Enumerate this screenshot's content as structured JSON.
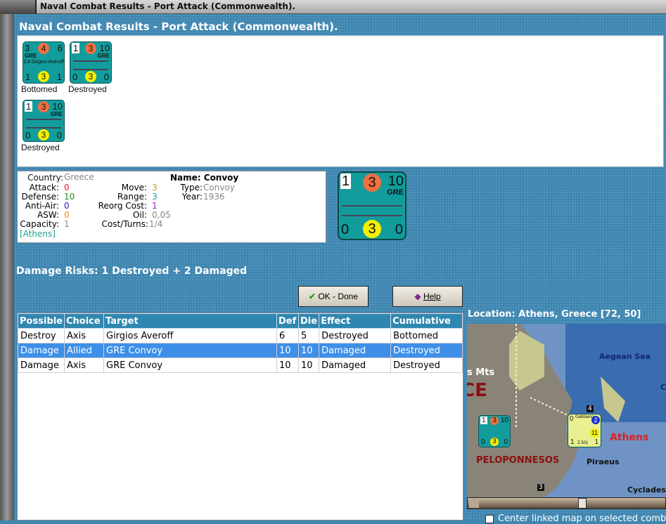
{
  "window_title": "Naval Combat Results - Port Attack (Commonwealth).",
  "dialog_title": "Naval Combat Results - Port Attack (Commonwealth).",
  "results": [
    {
      "attack": "3",
      "circle_top": "4",
      "defense": "6",
      "nation": "GRE",
      "name": "CA Girgios Averoff",
      "bl": "1",
      "circle_bottom": "3",
      "br": "1",
      "label": "Bottomed"
    },
    {
      "attack": "1",
      "circle_top": "3",
      "defense": "10",
      "nation": "GRE",
      "bl": "0",
      "circle_bottom": "3",
      "br": "0",
      "label": "Destroyed"
    },
    {
      "attack": "1",
      "circle_top": "3",
      "defense": "10",
      "nation": "GRE",
      "bl": "0",
      "circle_bottom": "3",
      "br": "0",
      "label": "Destroyed"
    }
  ],
  "info": {
    "country_label": "Country:",
    "country": "Greece",
    "attack_label": "Attack:",
    "attack": "0",
    "defense_label": "Defense:",
    "defense": "10",
    "antiair_label": "Anti-Air:",
    "antiair": "0",
    "asw_label": "ASW:",
    "asw": "0",
    "capacity_label": "Capacity:",
    "capacity": "1",
    "location": "[Athens]",
    "move_label": "Move:",
    "move": "3",
    "range_label": "Range:",
    "range": "3",
    "reorg_label": "Reorg Cost:",
    "reorg": "1",
    "oil_label": "Oil:",
    "oil": "0,05",
    "cost_label": "Cost/Turns:",
    "cost": "1/4",
    "name": "Name: Convoy",
    "type_label": "Type:",
    "type": "Convoy",
    "year_label": "Year:",
    "year": "1936",
    "colors": {
      "attack": "#e02020",
      "defense": "#209020",
      "antiair": "#2020c0",
      "asw": "#f09030",
      "move": "#c0a020",
      "range": "#20a0a0",
      "reorg": "#a020c0"
    }
  },
  "big_counter": {
    "attack": "1",
    "circle_top": "3",
    "defense": "10",
    "nation": "GRE",
    "bl": "0",
    "circle_bottom": "3",
    "br": "0"
  },
  "damage_risks": "Damage Risks:  1 Destroyed + 2 Damaged",
  "buttons": {
    "ok": "OK - Done",
    "help": "Help"
  },
  "table": {
    "headers": [
      "Possible",
      "Choice",
      "Target",
      "Def",
      "Die",
      "Effect",
      "Cumulative"
    ],
    "rows": [
      [
        "Destroy",
        "Axis",
        "Girgios Averoff",
        "6",
        "5",
        "Destroyed",
        "Bottomed"
      ],
      [
        "Damage",
        "Allied",
        "GRE Convoy",
        "10",
        "10",
        "Damaged",
        "Destroyed"
      ],
      [
        "Damage",
        "Axis",
        "GRE Convoy",
        "10",
        "10",
        "Damaged",
        "Destroyed"
      ]
    ]
  },
  "location": "Location:  Athens, Greece [72, 50]",
  "map": {
    "labels": {
      "mts": "s Mts",
      "sea": "Aegean Sea",
      "ce": "CE",
      "pelo": "PELOPONNESOS",
      "athens": "Athens",
      "piraeus": "Piraeus",
      "cyclades": "Cyclades",
      "c": "C"
    },
    "stack4": "4",
    "stack3": "3",
    "unit": {
      "name": "Gabbiano",
      "top_right": "2",
      "mid": "11",
      "bl": "1",
      "code": "Z.501",
      "br": "1",
      "tl": "0"
    },
    "convoy": {
      "attack": "1",
      "circle_top": "3",
      "defense": "10",
      "bl": "0",
      "circle_bottom": "3",
      "br": "0"
    }
  },
  "checkbox_label": "Center linked map on selected comb"
}
